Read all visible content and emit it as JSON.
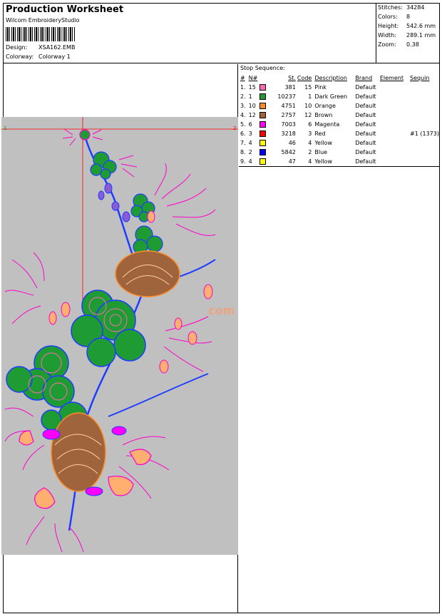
{
  "header": {
    "title": "Production Worksheet",
    "software": "Wilcom  EmbroideryStudio",
    "design_label": "Design:",
    "design_value": "XSA162.EMB",
    "colorway_label": "Colorway:",
    "colorway_value": "Colorway 1"
  },
  "stats": {
    "stitches_label": "Stitches:",
    "stitches_value": "34284",
    "colors_label": "Colors:",
    "colors_value": "8",
    "height_label": "Height:",
    "height_value": "542.6 mm",
    "width_label": "Width:",
    "width_value": "289.1 mm",
    "zoom_label": "Zoom:",
    "zoom_value": "0.38"
  },
  "design": {
    "marker_1": "1",
    "marker_2": "2",
    "watermark": "com"
  },
  "stop_sequence": {
    "title": "Stop Sequence:",
    "columns": [
      "#",
      "N#",
      "St.",
      "Code",
      "Description",
      "Brand",
      "Element",
      "Sequin"
    ],
    "rows": [
      {
        "num": "1.",
        "n": "15",
        "color": "#ff69b4",
        "st": "381",
        "code": "15",
        "desc": "Pink",
        "brand": "Default",
        "element": "",
        "sequin": ""
      },
      {
        "num": "2.",
        "n": "1",
        "color": "#1e9b32",
        "st": "10237",
        "code": "1",
        "desc": "Dark Green",
        "brand": "Default",
        "element": "",
        "sequin": ""
      },
      {
        "num": "3.",
        "n": "10",
        "color": "#ff8c28",
        "st": "4751",
        "code": "10",
        "desc": "Orange",
        "brand": "Default",
        "element": "",
        "sequin": ""
      },
      {
        "num": "4.",
        "n": "12",
        "color": "#a0643c",
        "st": "2757",
        "code": "12",
        "desc": "Brown",
        "brand": "Default",
        "element": "",
        "sequin": ""
      },
      {
        "num": "5.",
        "n": "6",
        "color": "#ff00ff",
        "st": "7003",
        "code": "6",
        "desc": "Magenta",
        "brand": "Default",
        "element": "",
        "sequin": ""
      },
      {
        "num": "6.",
        "n": "3",
        "color": "#ff0000",
        "st": "3218",
        "code": "3",
        "desc": "Red",
        "brand": "Default",
        "element": "",
        "sequin": "#1 (1373)"
      },
      {
        "num": "7.",
        "n": "4",
        "color": "#ffff00",
        "st": "46",
        "code": "4",
        "desc": "Yellow",
        "brand": "Default",
        "element": "",
        "sequin": ""
      },
      {
        "num": "8.",
        "n": "2",
        "color": "#0000ff",
        "st": "5842",
        "code": "2",
        "desc": "Blue",
        "brand": "Default",
        "element": "",
        "sequin": ""
      },
      {
        "num": "9.",
        "n": "4",
        "color": "#ffff00",
        "st": "47",
        "code": "4",
        "desc": "Yellow",
        "brand": "Default",
        "element": "",
        "sequin": ""
      }
    ]
  }
}
